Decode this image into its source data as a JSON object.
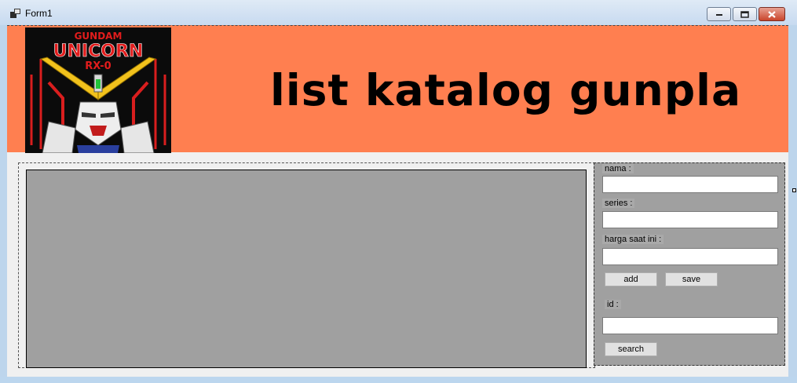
{
  "window": {
    "title": "Form1"
  },
  "banner": {
    "heading": "list katalog gunpla",
    "poster": {
      "line1": "GUNDAM",
      "line2": "UNICORN",
      "line3": "RX-0"
    }
  },
  "form": {
    "nama_label": "nama :",
    "series_label": "series :",
    "harga_label": "harga saat ini :",
    "id_label": "id :",
    "nama_value": "",
    "series_value": "",
    "harga_value": "",
    "id_value": "",
    "add_label": "add",
    "save_label": "save",
    "search_label": "search"
  },
  "colors": {
    "banner": "#ff7f50",
    "panel": "#a0a0a0",
    "grid": "#a0a0a0"
  },
  "icons": {
    "app": "form-app-icon",
    "minimize": "minimize-icon",
    "maximize": "maximize-icon",
    "close": "close-icon"
  }
}
